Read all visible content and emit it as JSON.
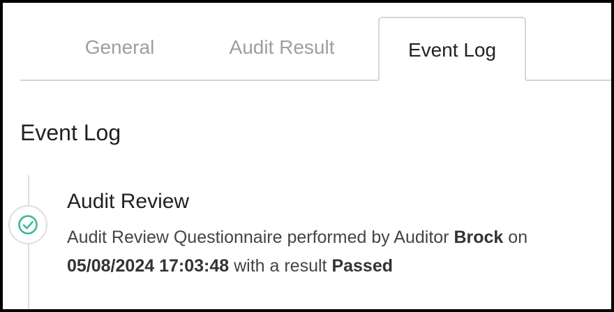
{
  "tabs": [
    {
      "label": "General",
      "active": false
    },
    {
      "label": "Audit Result",
      "active": false
    },
    {
      "label": "Event Log",
      "active": true
    }
  ],
  "section_title": "Event Log",
  "events": [
    {
      "icon": "check-circle-icon",
      "status_color": "#3bb89a",
      "title": "Audit Review",
      "desc_prefix": "Audit Review Questionnaire performed by Auditor ",
      "auditor": "Brock",
      "on_text": " on",
      "timestamp": "05/08/2024 17:03:48",
      "result_text": " with a result ",
      "result": "Passed"
    }
  ]
}
